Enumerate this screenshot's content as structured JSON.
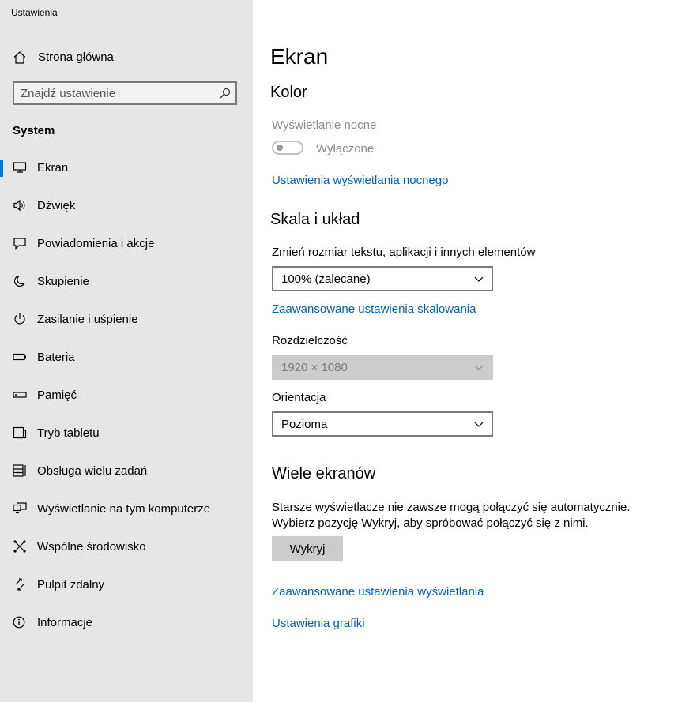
{
  "window": {
    "title": "Ustawienia"
  },
  "sidebar": {
    "home_label": "Strona główna",
    "search_placeholder": "Znajdź ustawienie",
    "section_title": "System",
    "items": [
      {
        "label": "Ekran",
        "icon": "monitor-icon",
        "active": true
      },
      {
        "label": "Dźwięk",
        "icon": "speaker-icon"
      },
      {
        "label": "Powiadomienia i akcje",
        "icon": "notification-icon"
      },
      {
        "label": "Skupienie",
        "icon": "moon-icon"
      },
      {
        "label": "Zasilanie i uśpienie",
        "icon": "power-icon"
      },
      {
        "label": "Bateria",
        "icon": "battery-icon"
      },
      {
        "label": "Pamięć",
        "icon": "storage-icon"
      },
      {
        "label": "Tryb tabletu",
        "icon": "tablet-icon"
      },
      {
        "label": "Obsługa wielu zadań",
        "icon": "multitasking-icon"
      },
      {
        "label": "Wyświetlanie na tym komputerze",
        "icon": "projecting-icon"
      },
      {
        "label": "Wspólne środowisko",
        "icon": "shared-experiences-icon"
      },
      {
        "label": "Pulpit zdalny",
        "icon": "remote-desktop-icon"
      },
      {
        "label": "Informacje",
        "icon": "info-icon"
      }
    ]
  },
  "main": {
    "page_title": "Ekran",
    "color": {
      "heading": "Kolor",
      "night_light_label": "Wyświetlanie nocne",
      "night_light_state": "Wyłączone",
      "night_light_settings_link": "Ustawienia wyświetlania nocnego"
    },
    "scale": {
      "heading": "Skala i układ",
      "size_label": "Zmień rozmiar tekstu, aplikacji i innych elementów",
      "size_value": "100% (zalecane)",
      "advanced_scaling_link": "Zaawansowane ustawienia skalowania",
      "resolution_label": "Rozdzielczość",
      "resolution_value": "1920 × 1080",
      "orientation_label": "Orientacja",
      "orientation_value": "Pozioma"
    },
    "multi": {
      "heading": "Wiele ekranów",
      "line1": "Starsze wyświetlacze nie zawsze mogą połączyć się automatycznie.",
      "line2": "Wybierz pozycję Wykryj, aby spróbować połączyć się z nimi.",
      "detect_button": "Wykryj",
      "advanced_display_link": "Zaawansowane ustawienia wyświetlania",
      "graphics_link": "Ustawienia grafiki"
    }
  },
  "colors": {
    "accent": "#0078d7",
    "link": "#0063b1",
    "sidebar_bg": "#e6e6e6"
  }
}
